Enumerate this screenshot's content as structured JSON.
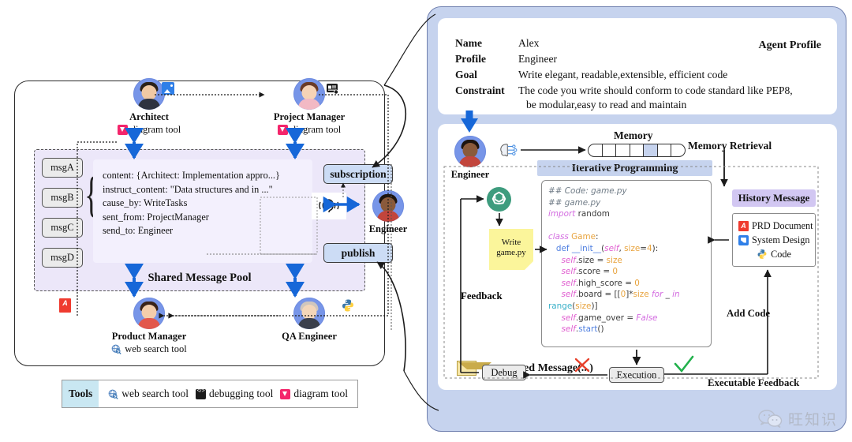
{
  "left": {
    "agents": [
      {
        "name": "Architect",
        "tool": "diagram tool",
        "tool_icon": "diagram-icon"
      },
      {
        "name": "Project Manager",
        "tool": "diagram tool",
        "tool_icon": "diagram-icon"
      },
      {
        "name": "Product Manager",
        "tool": "web search tool",
        "tool_icon": "web-search-icon"
      },
      {
        "name": "QA Engineer",
        "tool": "",
        "tool_icon": ""
      }
    ],
    "engineer_label": "Engineer",
    "pool": {
      "title": "Shared Message Pool",
      "chips": [
        "msgA",
        "msgB",
        "msgC",
        "msgD"
      ],
      "message_lines": [
        "content: {Architect: Implementation appro...}",
        "instruct_content: \"Data structures and in ...\"",
        "cause_by: WriteTasks",
        "sent_from: ProjectManager",
        "send_to: Engineer"
      ]
    },
    "subscription_label": "subscription",
    "publish_label": "publish",
    "tools_legend": {
      "tag": "Tools",
      "items": [
        {
          "label": "web search tool",
          "icon": "web-search-icon"
        },
        {
          "label": "debugging tool",
          "icon": "debugging-icon"
        },
        {
          "label": "diagram tool",
          "icon": "diagram-icon"
        }
      ]
    }
  },
  "right": {
    "profile": {
      "title": "Agent Profile",
      "rows": [
        {
          "key": "Name",
          "value": "Alex"
        },
        {
          "key": "Profile",
          "value": "Engineer"
        },
        {
          "key": "Goal",
          "value": "Write elegant, readable,extensible, efficient code"
        },
        {
          "key": "Constraint",
          "value": "The code you write should conform to code standard like PEP8,"
        },
        {
          "key": "",
          "value": "be modular,easy to read and maintain"
        }
      ]
    },
    "engineer_label": "Engineer",
    "memory_label": "Memory",
    "memory_retrieval_label": "Memory Retrieval",
    "memory_cells": 7,
    "memory_active_index": 4,
    "iterative_label": "Iterative Programming",
    "note_line1": "Write",
    "note_line2": "game.py",
    "feedback_label": "Feedback",
    "add_code_label": "Add Code",
    "executable_feedback_label": "Executable Feedback",
    "history": {
      "title": "History Message",
      "items": [
        {
          "label": "PRD Document",
          "icon": "pdf-icon"
        },
        {
          "label": "System Design",
          "icon": "system-design-icon"
        },
        {
          "label": "Code",
          "icon": "python-icon"
        }
      ]
    },
    "debug_label": "Debug",
    "execution_label": "Execution",
    "structured_message": "Structured Message(...)",
    "code": [
      {
        "t": "## Code: game.py",
        "c": "com"
      },
      {
        "t": "## game.py",
        "c": "com"
      },
      {
        "t": "import random",
        "c": "import"
      },
      {
        "t": "",
        "c": "blank"
      },
      {
        "t": "class Game:",
        "c": "class"
      },
      {
        "t": "  def __init__(self, size=4):",
        "c": "init"
      },
      {
        "t": "    self.size = size",
        "c": "assign_size"
      },
      {
        "t": "    self.score = 0",
        "c": "assign_score"
      },
      {
        "t": "    self.high_score = 0",
        "c": "assign_high"
      },
      {
        "t": "    self.board = [[0]*size for _ in",
        "c": "assign_board"
      },
      {
        "t": "range(size)]",
        "c": "range"
      },
      {
        "t": "    self.game_over = False",
        "c": "assign_over"
      },
      {
        "t": "    self.start()",
        "c": "start"
      }
    ]
  },
  "colors": {
    "panel_bg": "#c6d3ee",
    "pool_bg": "#ece7f9",
    "accent_blue": "#2f7fe8",
    "avatar_blue": "#7795e8",
    "history_purple": "#d2c7f2",
    "note_yellow": "#fbf59b",
    "check_green": "#22b14c",
    "cross_red": "#e8402a"
  },
  "watermark": "旺知识"
}
